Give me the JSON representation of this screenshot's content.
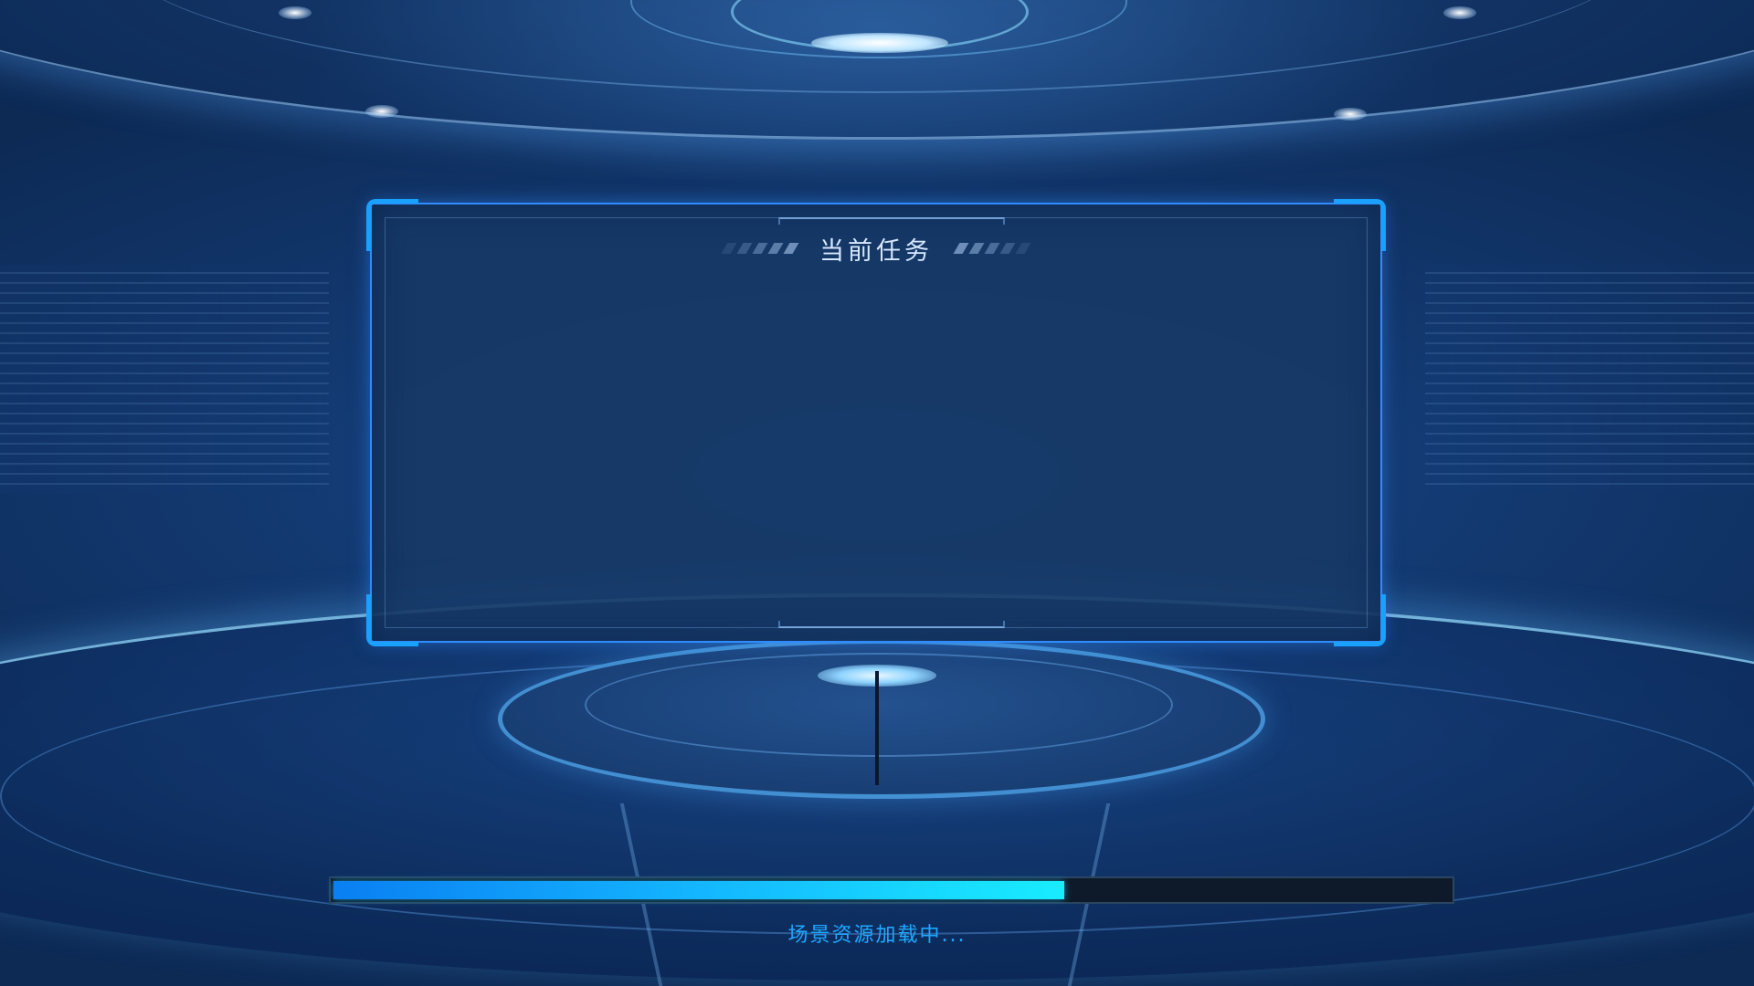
{
  "task_panel": {
    "title": "当前任务"
  },
  "loading": {
    "progress": 0.655,
    "status_text": "场景资源加载中..."
  },
  "colors": {
    "accent": "#2f8cff",
    "progress_start": "#0a7ff2",
    "progress_end": "#19ecff",
    "status_text": "#1fa8ff"
  }
}
